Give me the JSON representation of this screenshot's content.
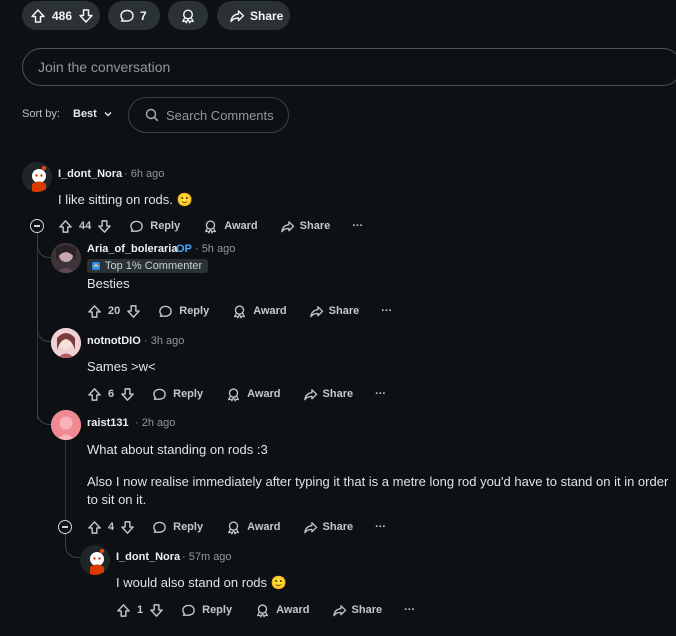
{
  "post_actions": {
    "votes": "486",
    "comments": "7",
    "share_label": "Share"
  },
  "composer": {
    "placeholder": "Join the conversation"
  },
  "sort": {
    "label": "Sort by:",
    "value": "Best"
  },
  "search": {
    "placeholder": "Search Comments"
  },
  "labels": {
    "reply": "Reply",
    "award": "Award",
    "share": "Share",
    "more": "···"
  },
  "comments": [
    {
      "user": "I_dont_Nora",
      "time": "6h ago",
      "body": "I like sitting on rods. 🙂",
      "votes": "44"
    },
    {
      "user": "Aria_of_boleraria",
      "op": "OP",
      "time": "5h ago",
      "flair": "Top 1% Commenter",
      "body": "Besties",
      "votes": "20"
    },
    {
      "user": "notnotDIO",
      "time": "3h ago",
      "body": "Sames >w<",
      "votes": "6"
    },
    {
      "user": "raist131",
      "time": "2h ago",
      "body": "What about standing on rods :3",
      "body2": "Also I now realise immediately after typing it that is a metre long rod you'd have to stand on it in order to sit on it.",
      "votes": "4"
    },
    {
      "user": "I_dont_Nora",
      "time": "57m ago",
      "body": "I would also stand on rods 🙂",
      "votes": "1"
    }
  ],
  "colors": {
    "background": "#0e1113",
    "pill": "#2a3236",
    "op_accent": "#4aa6ff"
  }
}
